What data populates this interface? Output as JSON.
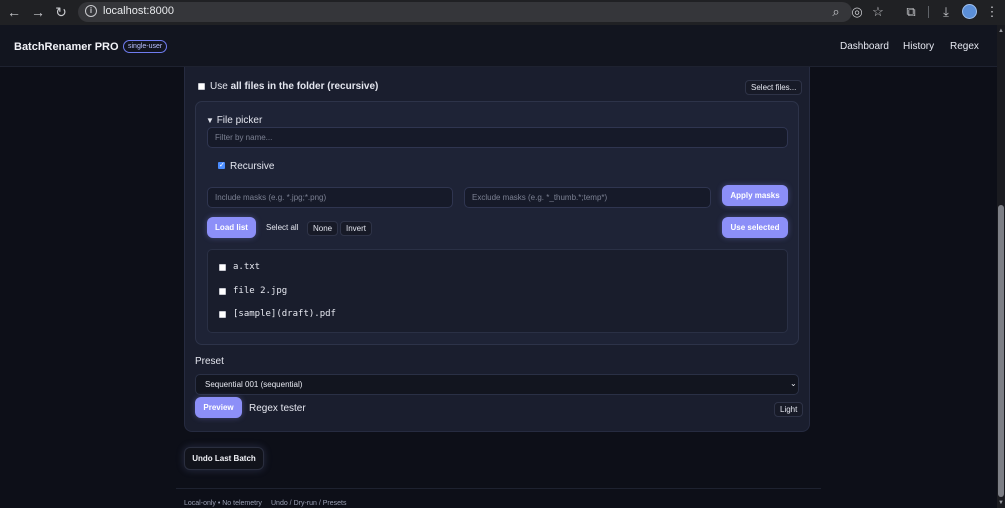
{
  "browser": {
    "url": "localhost:8000",
    "icons": [
      "back-icon",
      "forward-icon",
      "reload-icon",
      "info-icon",
      "zoom-icon",
      "eye-off-icon",
      "star-icon",
      "extensions-icon",
      "download-icon",
      "profile-icon",
      "menu-icon"
    ]
  },
  "header": {
    "brand": "BatchRenamer PRO",
    "badge": "single-user",
    "nav": [
      "Dashboard",
      "History",
      "Regex"
    ]
  },
  "source": {
    "use_all_prefix": "Use ",
    "use_all_bold": "all files in the folder (recursive)",
    "use_all_checked": false,
    "select_files_label": "Select files..."
  },
  "picker": {
    "summary": "File picker",
    "filter_placeholder": "Filter by name...",
    "recursive_label": "Recursive",
    "recursive_checked": true,
    "include_placeholder": "Include masks (e.g. *.jpg;*.png)",
    "exclude_placeholder": "Exclude masks (e.g. *_thumb.*;temp*)",
    "apply_label": "Apply masks",
    "load_label": "Load list",
    "select_all_label": "Select all",
    "none_label": "None",
    "invert_label": "Invert",
    "use_selected_label": "Use selected",
    "files": [
      {
        "name": "a.txt",
        "checked": false
      },
      {
        "name": "file 2.jpg",
        "checked": false
      },
      {
        "name": "[sample](draft).pdf",
        "checked": false
      }
    ]
  },
  "preset": {
    "label": "Preset",
    "selected": "Sequential 001 (sequential)"
  },
  "actions": {
    "preview_label": "Preview",
    "regex_tester_label": "Regex tester",
    "theme_label": "Light",
    "undo_label": "Undo Last Batch"
  },
  "footer": {
    "left": "Local-only • No telemetry",
    "right": "Undo / Dry-run / Presets"
  },
  "colors": {
    "accent": "#8c8ff8",
    "background": "#0d0f18",
    "panel": "#1a1e2e"
  }
}
